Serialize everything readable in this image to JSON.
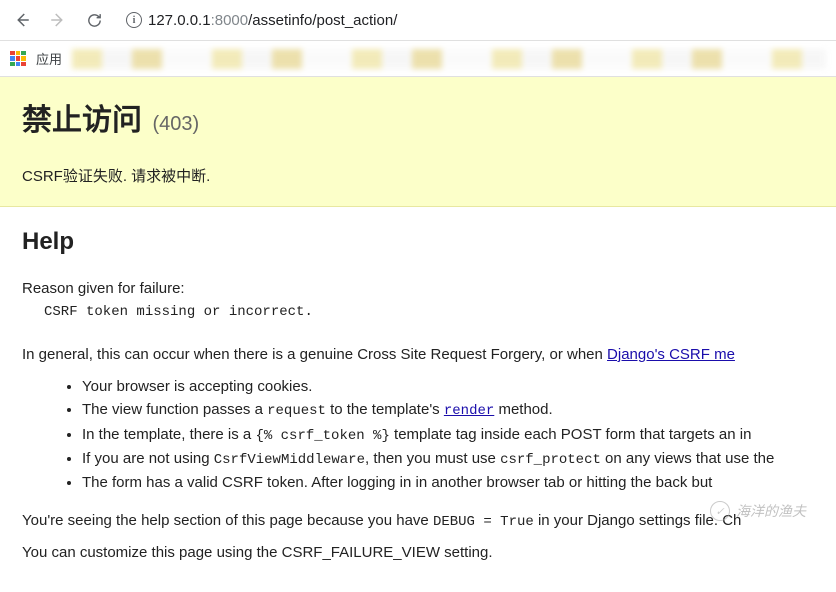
{
  "browser": {
    "url_host": "127.0.0.1",
    "url_port": ":8000",
    "url_path": "/assetinfo/post_action/",
    "apps_label": "应用"
  },
  "error": {
    "title": "禁止访问",
    "code": "(403)",
    "message": "CSRF验证失败. 请求被中断."
  },
  "help": {
    "title": "Help",
    "reason_label": "Reason given for failure:",
    "reason_text": "CSRF token missing or incorrect.",
    "general_prefix": "In general, this can occur when there is a genuine Cross Site Request Forgery, or when ",
    "general_link": "Django's CSRF me",
    "bullets": {
      "b1": "Your browser is accepting cookies.",
      "b2_a": "The view function passes a ",
      "b2_code": "request",
      "b2_b": " to the template's ",
      "b2_link": "render",
      "b2_c": " method.",
      "b3_a": "In the template, there is a ",
      "b3_code": "{% csrf_token %}",
      "b3_b": " template tag inside each POST form that targets an in",
      "b4_a": "If you are not using ",
      "b4_code1": "CsrfViewMiddleware",
      "b4_b": ", then you must use ",
      "b4_code2": "csrf_protect",
      "b4_c": " on any views that use the ",
      "b5": "The form has a valid CSRF token. After logging in in another browser tab or hitting the back but"
    },
    "debug_a": "You're seeing the help section of this page because you have ",
    "debug_code": "DEBUG = True",
    "debug_b": " in your Django settings file. Ch",
    "customize": "You can customize this page using the CSRF_FAILURE_VIEW setting."
  },
  "watermark": "海洋的渔夫"
}
